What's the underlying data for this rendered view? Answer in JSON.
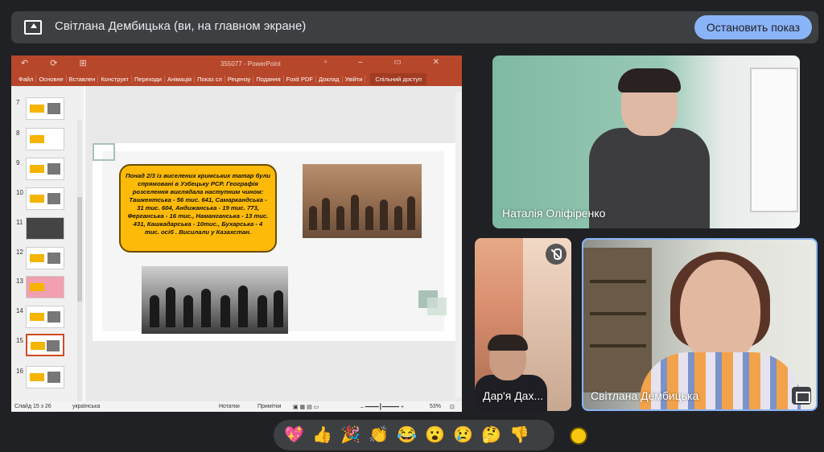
{
  "top": {
    "presenter_label": "Світлана Дембицька (ви, на главном экране)",
    "stop_button": "Остановить показ",
    "share_icon": "present-to-all-icon"
  },
  "ppt": {
    "title": "355077 - PowerPoint",
    "tabs": [
      "Файл",
      "Основне",
      "Вставлен",
      "Конструкт",
      "Переходи",
      "Анімація",
      "Показ сл",
      "Рецензу",
      "Подання",
      "Foxit PDF",
      "Доклад",
      "Увійти"
    ],
    "share": "Спільний доступ",
    "slide_numbers": [
      "7",
      "8",
      "9",
      "10",
      "11",
      "12",
      "13",
      "14",
      "15",
      "16"
    ],
    "selected_slide": "15",
    "slide_text": "Понад 2/3 із виселених кримських татар були спрямовані в Узбецьку РСР. Географія розселення виглядала наступним чином: Ташкентська - 56 тис. 641, Самаркандська - 31 тис. 604, Андижанська - 19 тис. 773, Ферганська - 16 тис., Наманганська - 13 тис. 431, Кашкадарська - 10тис., Бухарська - 4 тис. осіб . Висилали у Казахстан.",
    "status_slide": "Слайд 15 з 26",
    "status_lang": "українська",
    "status_notes": "Нотатки",
    "status_comments": "Примітки",
    "zoom": "53%",
    "accent": "#b7472a"
  },
  "participants": [
    {
      "name": "Наталія Оліфіренко"
    },
    {
      "name": "Дар'я Дах..."
    },
    {
      "name": "Світлана Дембицька"
    }
  ],
  "reactions": [
    "💖",
    "👍",
    "🎉",
    "👏",
    "😂",
    "😮",
    "😢",
    "🤔",
    "👎"
  ],
  "accent_blue": "#8ab4f8"
}
